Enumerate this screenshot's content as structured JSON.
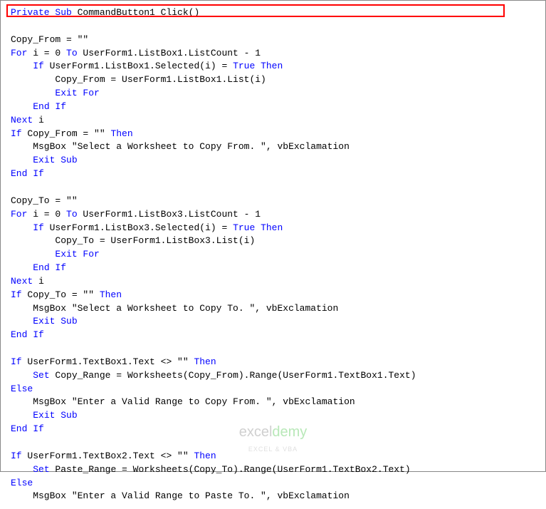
{
  "code": {
    "lines": [
      {
        "parts": [
          {
            "t": "Private Sub",
            "c": "keyword"
          },
          {
            "t": " CommandButton1_Click()",
            "c": "normal"
          }
        ]
      },
      {
        "parts": [
          {
            "t": "",
            "c": "normal"
          }
        ]
      },
      {
        "parts": [
          {
            "t": "Copy_From = \"\"",
            "c": "normal"
          }
        ]
      },
      {
        "parts": [
          {
            "t": "For",
            "c": "keyword"
          },
          {
            "t": " i = 0 ",
            "c": "normal"
          },
          {
            "t": "To",
            "c": "keyword"
          },
          {
            "t": " UserForm1.ListBox1.ListCount - 1",
            "c": "normal"
          }
        ]
      },
      {
        "parts": [
          {
            "t": "    ",
            "c": "normal"
          },
          {
            "t": "If",
            "c": "keyword"
          },
          {
            "t": " UserForm1.ListBox1.Selected(i) = ",
            "c": "normal"
          },
          {
            "t": "True Then",
            "c": "keyword"
          }
        ]
      },
      {
        "parts": [
          {
            "t": "        Copy_From = UserForm1.ListBox1.List(i)",
            "c": "normal"
          }
        ]
      },
      {
        "parts": [
          {
            "t": "        ",
            "c": "normal"
          },
          {
            "t": "Exit For",
            "c": "keyword"
          }
        ]
      },
      {
        "parts": [
          {
            "t": "    ",
            "c": "normal"
          },
          {
            "t": "End If",
            "c": "keyword"
          }
        ]
      },
      {
        "parts": [
          {
            "t": "Next",
            "c": "keyword"
          },
          {
            "t": " i",
            "c": "normal"
          }
        ]
      },
      {
        "parts": [
          {
            "t": "If",
            "c": "keyword"
          },
          {
            "t": " Copy_From = \"\" ",
            "c": "normal"
          },
          {
            "t": "Then",
            "c": "keyword"
          }
        ]
      },
      {
        "parts": [
          {
            "t": "    MsgBox \"Select a Worksheet to Copy From. \", vbExclamation",
            "c": "normal"
          }
        ]
      },
      {
        "parts": [
          {
            "t": "    ",
            "c": "normal"
          },
          {
            "t": "Exit Sub",
            "c": "keyword"
          }
        ]
      },
      {
        "parts": [
          {
            "t": "End If",
            "c": "keyword"
          }
        ]
      },
      {
        "parts": [
          {
            "t": "",
            "c": "normal"
          }
        ]
      },
      {
        "parts": [
          {
            "t": "Copy_To = \"\"",
            "c": "normal"
          }
        ]
      },
      {
        "parts": [
          {
            "t": "For",
            "c": "keyword"
          },
          {
            "t": " i = 0 ",
            "c": "normal"
          },
          {
            "t": "To",
            "c": "keyword"
          },
          {
            "t": " UserForm1.ListBox3.ListCount - 1",
            "c": "normal"
          }
        ]
      },
      {
        "parts": [
          {
            "t": "    ",
            "c": "normal"
          },
          {
            "t": "If",
            "c": "keyword"
          },
          {
            "t": " UserForm1.ListBox3.Selected(i) = ",
            "c": "normal"
          },
          {
            "t": "True Then",
            "c": "keyword"
          }
        ]
      },
      {
        "parts": [
          {
            "t": "        Copy_To = UserForm1.ListBox3.List(i)",
            "c": "normal"
          }
        ]
      },
      {
        "parts": [
          {
            "t": "        ",
            "c": "normal"
          },
          {
            "t": "Exit For",
            "c": "keyword"
          }
        ]
      },
      {
        "parts": [
          {
            "t": "    ",
            "c": "normal"
          },
          {
            "t": "End If",
            "c": "keyword"
          }
        ]
      },
      {
        "parts": [
          {
            "t": "Next",
            "c": "keyword"
          },
          {
            "t": " i",
            "c": "normal"
          }
        ]
      },
      {
        "parts": [
          {
            "t": "If",
            "c": "keyword"
          },
          {
            "t": " Copy_To = \"\" ",
            "c": "normal"
          },
          {
            "t": "Then",
            "c": "keyword"
          }
        ]
      },
      {
        "parts": [
          {
            "t": "    MsgBox \"Select a Worksheet to Copy To. \", vbExclamation",
            "c": "normal"
          }
        ]
      },
      {
        "parts": [
          {
            "t": "    ",
            "c": "normal"
          },
          {
            "t": "Exit Sub",
            "c": "keyword"
          }
        ]
      },
      {
        "parts": [
          {
            "t": "End If",
            "c": "keyword"
          }
        ]
      },
      {
        "parts": [
          {
            "t": "",
            "c": "normal"
          }
        ]
      },
      {
        "parts": [
          {
            "t": "If",
            "c": "keyword"
          },
          {
            "t": " UserForm1.TextBox1.Text <> \"\" ",
            "c": "normal"
          },
          {
            "t": "Then",
            "c": "keyword"
          }
        ]
      },
      {
        "parts": [
          {
            "t": "    ",
            "c": "normal"
          },
          {
            "t": "Set",
            "c": "keyword"
          },
          {
            "t": " Copy_Range = Worksheets(Copy_From).Range(UserForm1.TextBox1.Text)",
            "c": "normal"
          }
        ]
      },
      {
        "parts": [
          {
            "t": "Else",
            "c": "keyword"
          }
        ]
      },
      {
        "parts": [
          {
            "t": "    MsgBox \"Enter a Valid Range to Copy From. \", vbExclamation",
            "c": "normal"
          }
        ]
      },
      {
        "parts": [
          {
            "t": "    ",
            "c": "normal"
          },
          {
            "t": "Exit Sub",
            "c": "keyword"
          }
        ]
      },
      {
        "parts": [
          {
            "t": "End If",
            "c": "keyword"
          }
        ]
      },
      {
        "parts": [
          {
            "t": "",
            "c": "normal"
          }
        ]
      },
      {
        "parts": [
          {
            "t": "If",
            "c": "keyword"
          },
          {
            "t": " UserForm1.TextBox2.Text <> \"\" ",
            "c": "normal"
          },
          {
            "t": "Then",
            "c": "keyword"
          }
        ]
      },
      {
        "parts": [
          {
            "t": "    ",
            "c": "normal"
          },
          {
            "t": "Set",
            "c": "keyword"
          },
          {
            "t": " Paste_Range = Worksheets(Copy_To).Range(UserForm1.TextBox2.Text)",
            "c": "normal"
          }
        ]
      },
      {
        "parts": [
          {
            "t": "Else",
            "c": "keyword"
          }
        ]
      },
      {
        "parts": [
          {
            "t": "    MsgBox \"Enter a Valid Range to Paste To. \", vbExclamation",
            "c": "normal"
          }
        ]
      }
    ]
  },
  "watermark": {
    "main_left": "excel",
    "main_right": "demy",
    "sub": "EXCEL & VBA"
  }
}
